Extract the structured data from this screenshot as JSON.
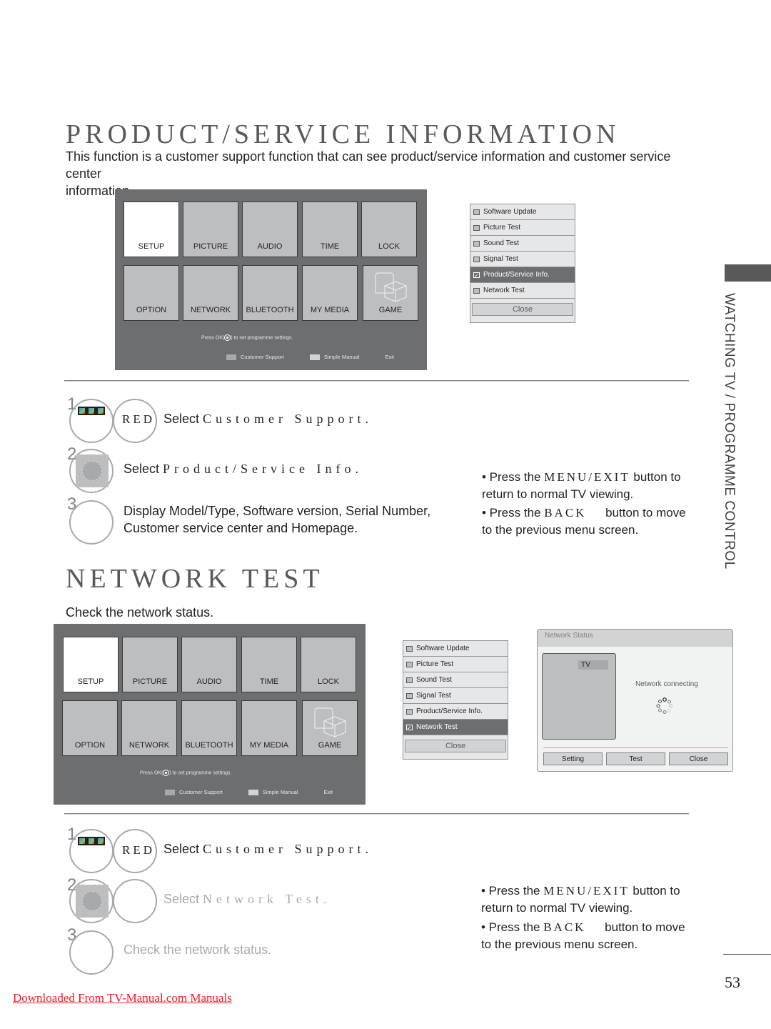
{
  "section1": {
    "title": "PRODUCT/SERVICE INFORMATION",
    "intro_line1": "This function is a customer support function that can see product/service information and customer service center",
    "intro_line2": "information."
  },
  "tv_menu": {
    "tiles": [
      "SETUP",
      "PICTURE",
      "AUDIO",
      "TIME",
      "LOCK",
      "OPTION",
      "NETWORK",
      "BLUETOOTH",
      "MY MEDIA",
      "GAME"
    ],
    "active_tile": "SETUP",
    "hint_prefix": "Press OK(",
    "hint_suffix": ") to set programme settings.",
    "footer": {
      "customer_support": "Customer Support",
      "simple_manual": "Simple Manual",
      "exit": "Exit"
    }
  },
  "support_list_1": {
    "items": [
      "Software Update",
      "Picture Test",
      "Sound Test",
      "Signal Test",
      "Product/Service Info.",
      "Network Test"
    ],
    "selected": "Product/Service Info.",
    "close": "Close"
  },
  "steps1": [
    {
      "num": "1",
      "button": "RED",
      "prefix": "Select ",
      "target": "Customer Support."
    },
    {
      "num": "2",
      "prefix": "Select ",
      "target": "Product/Service Info."
    },
    {
      "num": "3",
      "line1": "Display Model/Type, Software version, Serial Number,",
      "line2": "Customer service center and Homepage."
    }
  ],
  "notes": {
    "n1_prefix": "• Press the ",
    "n1_button": "MENU/EXIT",
    "n1_suffix": " button to",
    "n1_line2": "return to normal TV viewing.",
    "n2_prefix": "• Press the ",
    "n2_button": "BACK",
    "n2_suffix": " button to move",
    "n2_line2": "to the previous menu screen."
  },
  "side_tab": {
    "label": "WATCHING TV / PROGRAMME CONTROL"
  },
  "section2": {
    "title": "NETWORK TEST",
    "intro": "Check the network status."
  },
  "support_list_2": {
    "items": [
      "Software Update",
      "Picture Test",
      "Sound Test",
      "Signal Test",
      "Product/Service Info.",
      "Network Test"
    ],
    "selected": "Network Test",
    "close": "Close"
  },
  "network_status": {
    "title": "Network Status",
    "tv_label": "TV",
    "status": "Network connecting",
    "buttons": [
      "Setting",
      "Test",
      "Close"
    ]
  },
  "steps2": [
    {
      "num": "1",
      "button": "RED",
      "prefix": "Select ",
      "target": "Customer Support."
    },
    {
      "num": "2",
      "prefix": "Select ",
      "target": "Network Test."
    },
    {
      "num": "3",
      "text": "Check the network status."
    }
  ],
  "footer": {
    "page_number": "53",
    "download_link": "Downloaded From TV-Manual.com Manuals"
  },
  "colors": {
    "menu_bg": "#6d6e70",
    "tile_bg": "#bcbec0",
    "selected_row": "#6d6e70",
    "link_red": "#ed1c24"
  }
}
